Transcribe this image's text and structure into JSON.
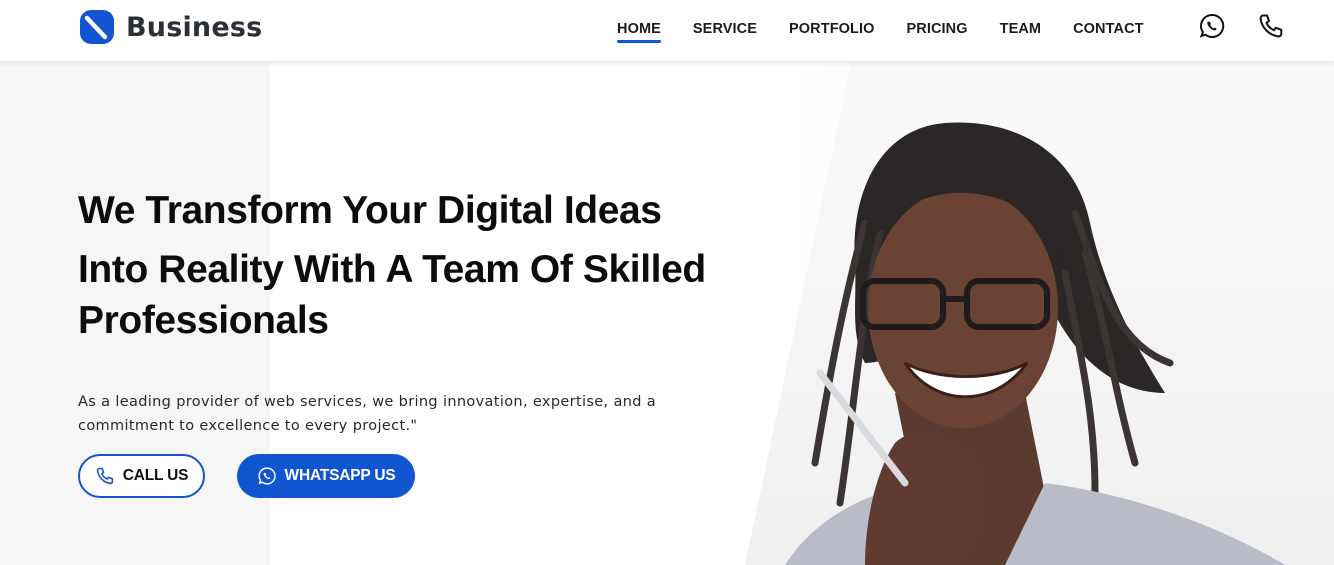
{
  "brand": {
    "name": "Business",
    "accent": "#1155d0"
  },
  "nav": {
    "items": [
      {
        "label": "HOME",
        "active": true
      },
      {
        "label": "SERVICE",
        "active": false
      },
      {
        "label": "PORTFOLIO",
        "active": false
      },
      {
        "label": "PRICING",
        "active": false
      },
      {
        "label": "TEAM",
        "active": false
      },
      {
        "label": "CONTACT",
        "active": false
      }
    ]
  },
  "header_icons": {
    "whatsapp": "whatsapp-icon",
    "phone": "phone-icon"
  },
  "hero": {
    "headline_line1": "We Transform Your Digital Ideas",
    "headline_line2": "Into Reality With A Team Of Skilled",
    "headline_line3": "Professionals",
    "subtext": "As a leading provider of web services, we bring innovation, expertise, and a commitment to excellence to every project.\"",
    "call_label": "CALL US",
    "whatsapp_label": "WHATSAPP US"
  }
}
